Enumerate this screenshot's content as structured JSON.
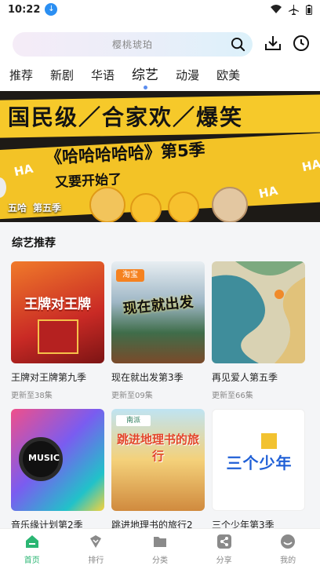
{
  "status": {
    "time": "10:22",
    "download_badge": "↓"
  },
  "search": {
    "placeholder": "樱桃琥珀"
  },
  "tabs": [
    {
      "label": "推荐"
    },
    {
      "label": "新剧"
    },
    {
      "label": "华语"
    },
    {
      "label": "综艺",
      "active": true
    },
    {
      "label": "动漫"
    },
    {
      "label": "欧美"
    }
  ],
  "banner": {
    "line1": "国民级／合家欢／爆笑",
    "line2": "《哈哈哈哈哈》第5季",
    "line3": "又要开始了",
    "caption_title": "五哈",
    "caption_season": "第五季",
    "ha": "HA"
  },
  "section": {
    "title": "综艺推荐",
    "cards": [
      {
        "name": "王牌对王牌第九季",
        "sub": "更新至38集",
        "thumb_text": "王牌对王牌"
      },
      {
        "name": "现在就出发第3季",
        "sub": "更新至09集",
        "thumb_text": "现在就出发"
      },
      {
        "name": "再见爱人第五季",
        "sub": "更新至66集",
        "thumb_text": ""
      },
      {
        "name": "音乐缘计划第2季",
        "sub": "",
        "thumb_text": "MUSIC"
      },
      {
        "name": "跳进地理书的旅行2",
        "sub": "",
        "thumb_text": "跳进地理书的旅行"
      },
      {
        "name": "三个少年第3季",
        "sub": "",
        "thumb_text": "三个少年"
      }
    ]
  },
  "nav": [
    {
      "label": "首页",
      "icon": "home-icon",
      "active": true
    },
    {
      "label": "排行",
      "icon": "rank-icon"
    },
    {
      "label": "分类",
      "icon": "folder-icon"
    },
    {
      "label": "分享",
      "icon": "share-icon"
    },
    {
      "label": "我的",
      "icon": "profile-icon"
    }
  ],
  "colors": {
    "accent": "#2bb673",
    "banner_yellow": "#f6c92a",
    "tab_dot": "#5b8def"
  }
}
